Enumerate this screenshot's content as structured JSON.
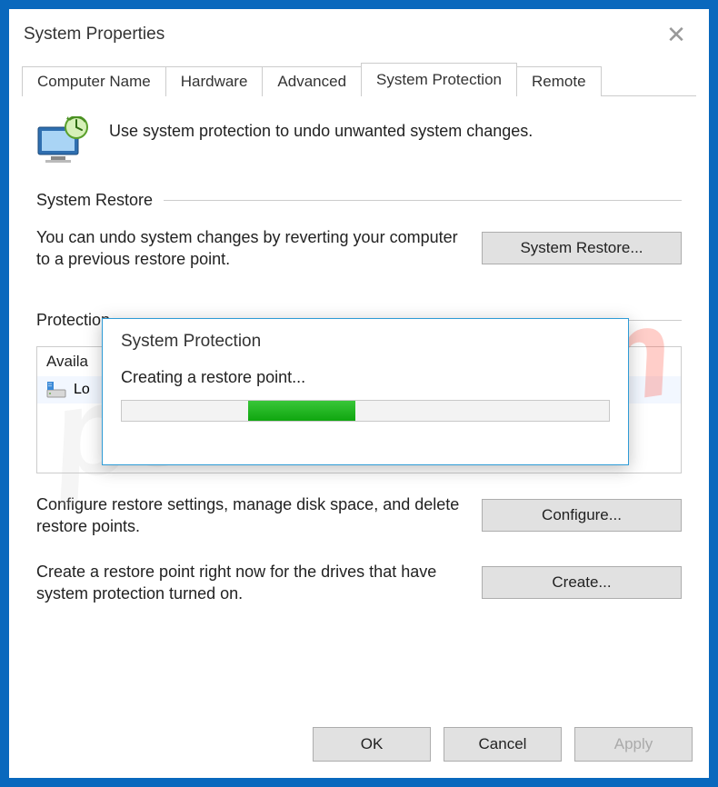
{
  "window": {
    "title": "System Properties"
  },
  "tabs": {
    "computer_name": "Computer Name",
    "hardware": "Hardware",
    "advanced": "Advanced",
    "system_protection": "System Protection",
    "remote": "Remote"
  },
  "intro": "Use system protection to undo unwanted system changes.",
  "restore": {
    "header": "System Restore",
    "text": "You can undo system changes by reverting your computer to a previous restore point.",
    "button": "System Restore..."
  },
  "protection": {
    "header": "Protection",
    "available": "Availa",
    "drive_name": "Lo",
    "configure_text": "Configure restore settings, manage disk space, and delete restore points.",
    "configure_button": "Configure...",
    "create_text": "Create a restore point right now for the drives that have system protection turned on.",
    "create_button": "Create..."
  },
  "footer": {
    "ok": "OK",
    "cancel": "Cancel",
    "apply": "Apply"
  },
  "modal": {
    "title": "System Protection",
    "text": "Creating a restore point..."
  },
  "watermark_base": "pcrisk",
  "watermark_ext": ".com"
}
